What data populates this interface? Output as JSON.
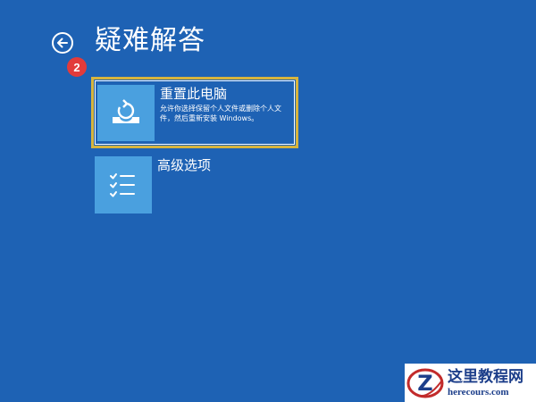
{
  "header": {
    "back_icon": "arrow-left-circle-icon",
    "title": "疑难解答"
  },
  "step_badge": "2",
  "options": [
    {
      "title": "重置此电脑",
      "description": "允许你选择保留个人文件或删除个人文件，然后重新安装 Windows。",
      "icon": "reset-pc-icon",
      "selected": true
    },
    {
      "title": "高级选项",
      "description": "",
      "icon": "checklist-icon",
      "selected": false
    }
  ],
  "watermark": {
    "name": "这里教程网",
    "url": "herecours.com",
    "logo_letter": "Z"
  },
  "colors": {
    "background": "#1e62b4",
    "tile": "#4aa0df",
    "selection_border": "#d7b53e",
    "badge": "#e23b3b",
    "watermark_text": "#1c3e8a"
  }
}
